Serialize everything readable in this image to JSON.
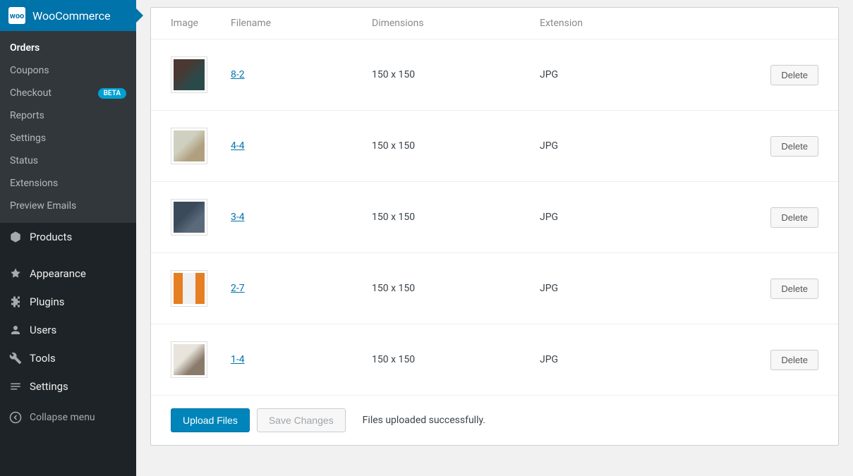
{
  "sidebar": {
    "header": "WooCommerce",
    "submenu": [
      {
        "label": "Orders",
        "active": true
      },
      {
        "label": "Coupons"
      },
      {
        "label": "Checkout",
        "badge": "BETA"
      },
      {
        "label": "Reports"
      },
      {
        "label": "Settings"
      },
      {
        "label": "Status"
      },
      {
        "label": "Extensions"
      },
      {
        "label": "Preview Emails"
      }
    ],
    "menu": [
      {
        "label": "Products",
        "icon": "products"
      },
      {
        "label": "Appearance",
        "icon": "appearance"
      },
      {
        "label": "Plugins",
        "icon": "plugins"
      },
      {
        "label": "Users",
        "icon": "users"
      },
      {
        "label": "Tools",
        "icon": "tools"
      },
      {
        "label": "Settings",
        "icon": "settings"
      }
    ],
    "collapse": "Collapse menu"
  },
  "table": {
    "headers": {
      "image": "Image",
      "filename": "Filename",
      "dimensions": "Dimensions",
      "extension": "Extension"
    },
    "rows": [
      {
        "filename": "8-2",
        "dimensions": "150 x 150",
        "extension": "JPG",
        "thumb": "linear-gradient(135deg,#4a3832 30%,#2a4a4a 70%)"
      },
      {
        "filename": "4-4",
        "dimensions": "150 x 150",
        "extension": "JPG",
        "thumb": "linear-gradient(135deg,#d0d0c0 40%,#b0a080 70%)"
      },
      {
        "filename": "3-4",
        "dimensions": "150 x 150",
        "extension": "JPG",
        "thumb": "linear-gradient(135deg,#3a4a5a 40%,#5a6a7a 70%)"
      },
      {
        "filename": "2-7",
        "dimensions": "150 x 150",
        "extension": "JPG",
        "thumb": "linear-gradient(90deg,#e67e22 30%,#f0f0f0 30%,#f0f0f0 70%,#e67e22 70%)"
      },
      {
        "filename": "1-4",
        "dimensions": "150 x 150",
        "extension": "JPG",
        "thumb": "linear-gradient(135deg,#e8e4dc 40%,#8a7a6a 70%)"
      }
    ],
    "delete_label": "Delete"
  },
  "footer": {
    "upload": "Upload Files",
    "save": "Save Changes",
    "status": "Files uploaded successfully."
  }
}
